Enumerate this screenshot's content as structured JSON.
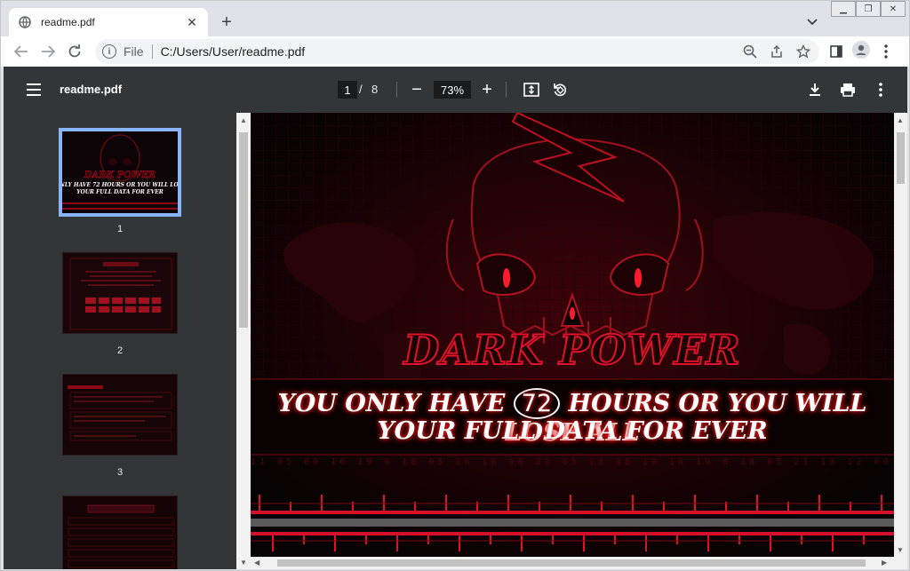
{
  "browser": {
    "tab_title": "readme.pdf",
    "omnibox_scheme": "File",
    "omnibox_url": "C:/Users/User/readme.pdf"
  },
  "pdf_toolbar": {
    "doc_title": "readme.pdf",
    "current_page": "1",
    "page_separator": "/",
    "total_pages": "8",
    "zoom": "73%"
  },
  "thumbnails": [
    {
      "num": "1",
      "active": true
    },
    {
      "num": "2",
      "active": false
    },
    {
      "num": "3",
      "active": false
    }
  ],
  "page": {
    "title": "DARK POWER",
    "line1_before": "YOU ONLY HAVE",
    "hours": "72",
    "line1_after": "HOURS OR YOU WILL LOSE ALL",
    "line2": "YOUR FULL DATA FOR EVER"
  },
  "colors": {
    "viewer_toolbar": "#323639",
    "viewer_bg": "#525659",
    "accent_red": "#e3122b",
    "thumb_highlight": "#8ab4f8"
  }
}
